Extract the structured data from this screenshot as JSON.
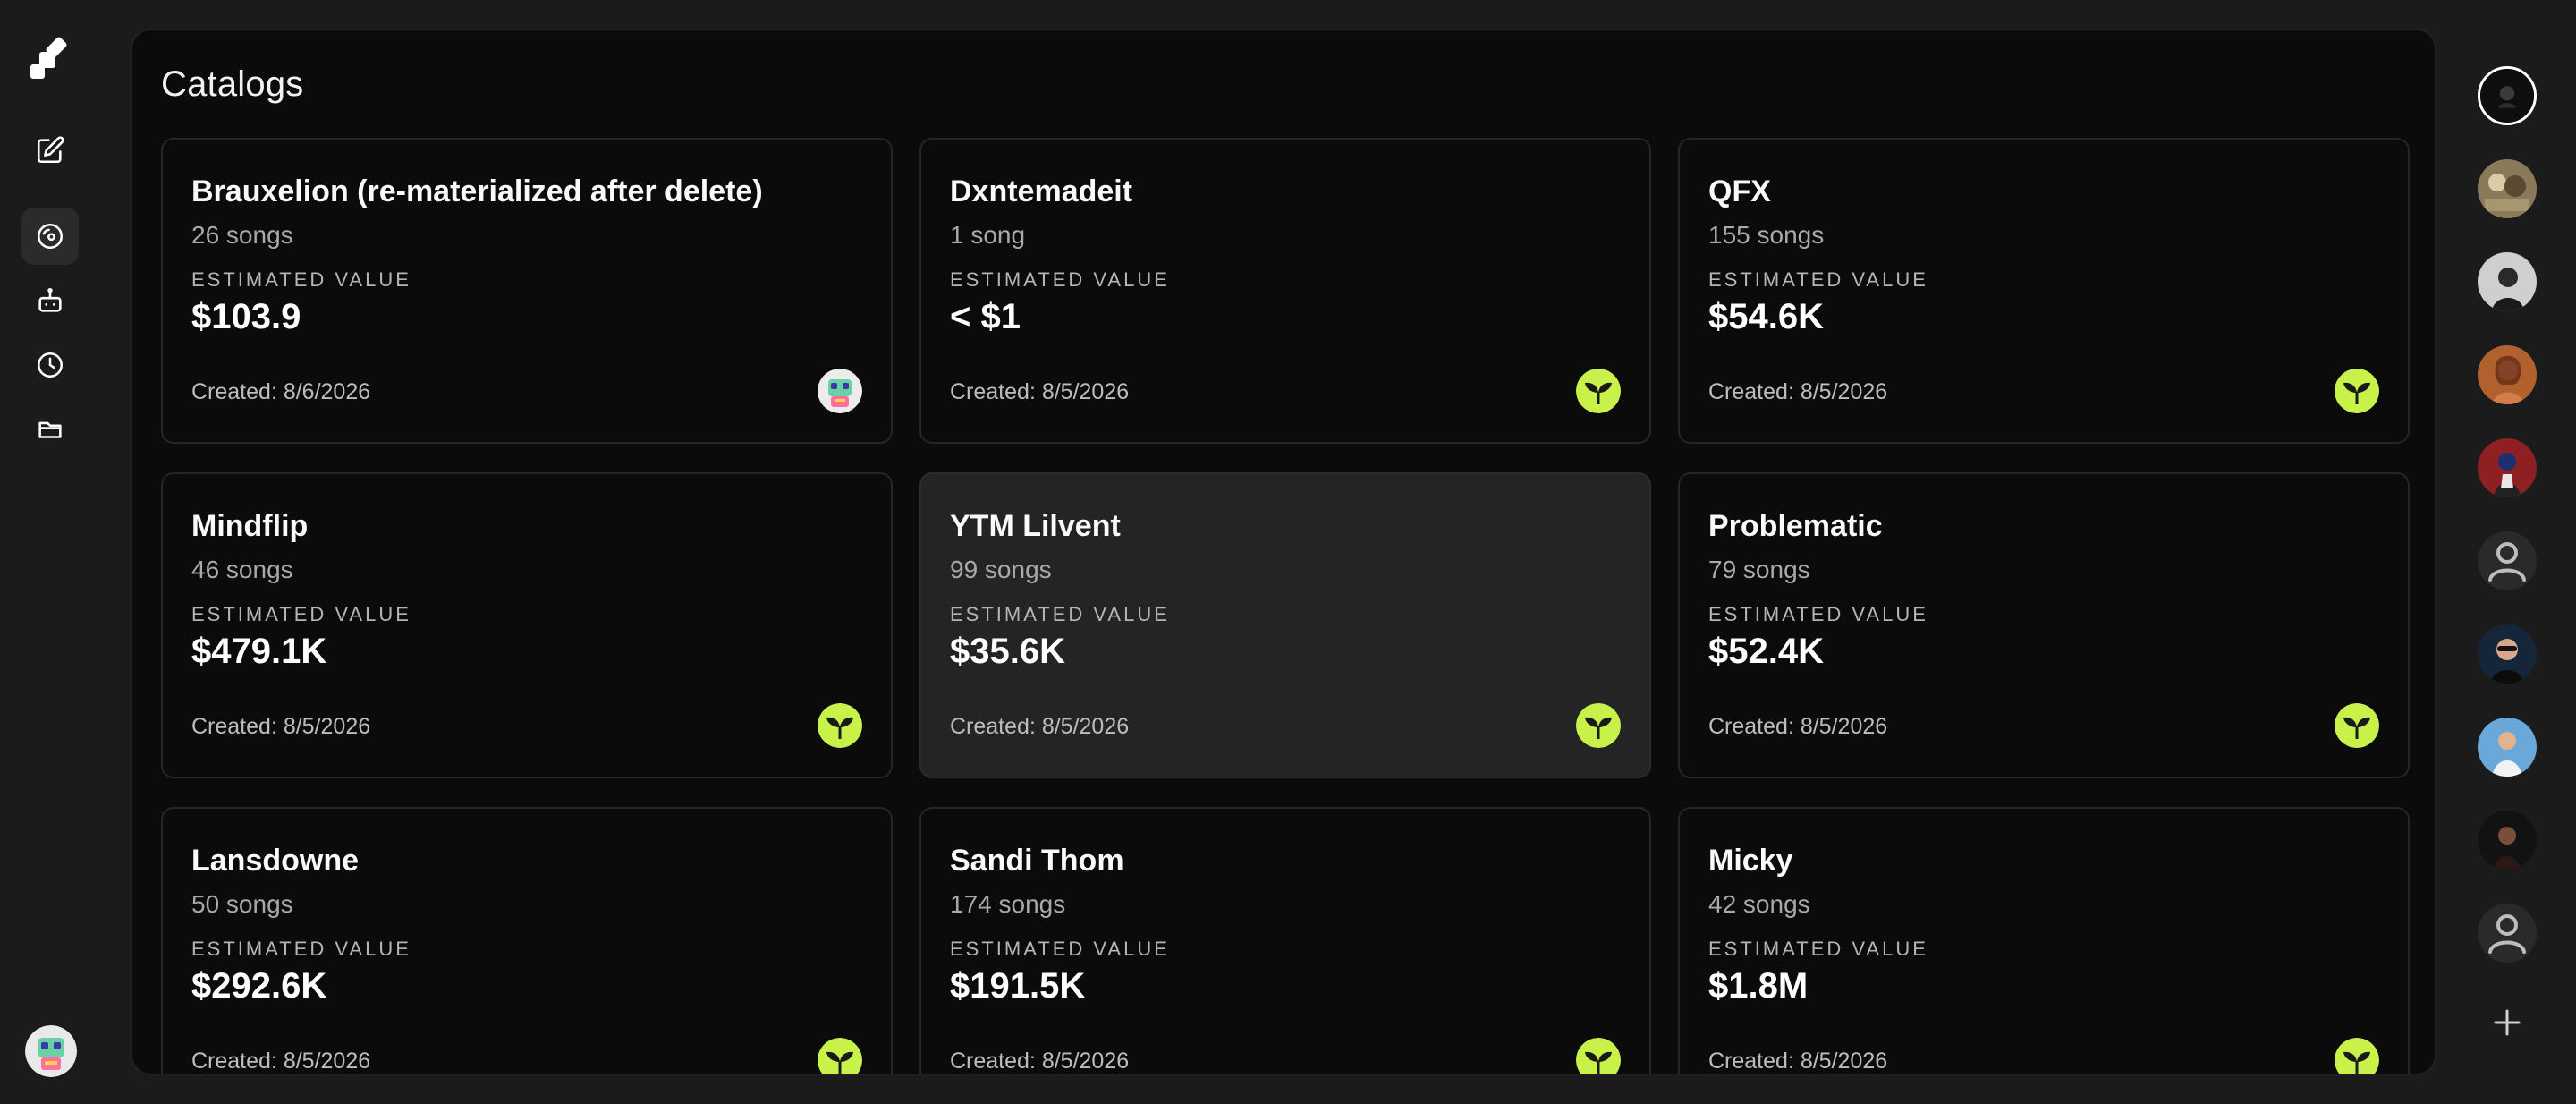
{
  "page": {
    "title": "Catalogs"
  },
  "sidebar": {
    "icons": [
      "logo-icon",
      "edit-icon",
      "catalog-disc-icon",
      "robot-icon",
      "clock-icon",
      "folder-icon"
    ],
    "active": "catalog-disc-icon"
  },
  "labels": {
    "estimated_value": "ESTIMATED VALUE"
  },
  "catalogs": [
    {
      "name": "Brauxelion (re-materialized after delete)",
      "songs": "26 songs",
      "value": "$103.9",
      "created": "Created: 8/6/2026",
      "icon": "robot-avatar-icon"
    },
    {
      "name": "Dxntemadeit",
      "songs": "1 song",
      "value": "< $1",
      "created": "Created: 8/5/2026",
      "icon": "sprout-icon"
    },
    {
      "name": "QFX",
      "songs": "155 songs",
      "value": "$54.6K",
      "created": "Created: 8/5/2026",
      "icon": "sprout-icon"
    },
    {
      "name": "Mindflip",
      "songs": "46 songs",
      "value": "$479.1K",
      "created": "Created: 8/5/2026",
      "icon": "sprout-icon"
    },
    {
      "name": "YTM Lilvent",
      "songs": "99 songs",
      "value": "$35.6K",
      "created": "Created: 8/5/2026",
      "icon": "sprout-icon"
    },
    {
      "name": "Problematic",
      "songs": "79 songs",
      "value": "$52.4K",
      "created": "Created: 8/5/2026",
      "icon": "sprout-icon"
    },
    {
      "name": "Lansdowne",
      "songs": "50 songs",
      "value": "$292.6K",
      "created": "Created: 8/5/2026",
      "icon": "sprout-icon"
    },
    {
      "name": "Sandi Thom",
      "songs": "174 songs",
      "value": "$191.5K",
      "created": "Created: 8/5/2026",
      "icon": "sprout-icon"
    },
    {
      "name": "Micky",
      "songs": "42 songs",
      "value": "$1.8M",
      "created": "Created: 8/5/2026",
      "icon": "sprout-icon"
    }
  ],
  "right_rail": {
    "avatars": [
      "user-avatar-1",
      "user-avatar-2",
      "user-avatar-3",
      "user-avatar-4",
      "user-avatar-5",
      "default-user-icon",
      "user-avatar-6",
      "user-avatar-7",
      "user-avatar-8",
      "default-user-icon"
    ],
    "selected_index": 0,
    "add_icon": "plus-icon"
  },
  "colors": {
    "sprout_bg": "#c8f24a",
    "accent": "#ffffff",
    "panel_bg": "#0b0b0b",
    "page_bg": "#1b1b1b"
  }
}
